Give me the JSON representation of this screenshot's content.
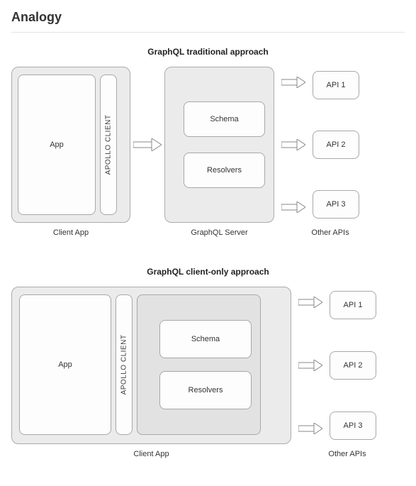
{
  "heading": "Analogy",
  "section1": {
    "title": "GraphQL traditional approach",
    "client_label": "Client App",
    "server_label": "GraphQL Server",
    "apis_label": "Other APIs",
    "app": "App",
    "apollo": "APOLLO CLIENT",
    "schema": "Schema",
    "resolvers": "Resolvers",
    "api1": "API 1",
    "api2": "API 2",
    "api3": "API 3"
  },
  "section2": {
    "title": "GraphQL client-only approach",
    "client_label": "Client App",
    "apis_label": "Other APIs",
    "app": "App",
    "apollo": "APOLLO CLIENT",
    "schema": "Schema",
    "resolvers": "Resolvers",
    "api1": "API 1",
    "api2": "API 2",
    "api3": "API 3"
  }
}
